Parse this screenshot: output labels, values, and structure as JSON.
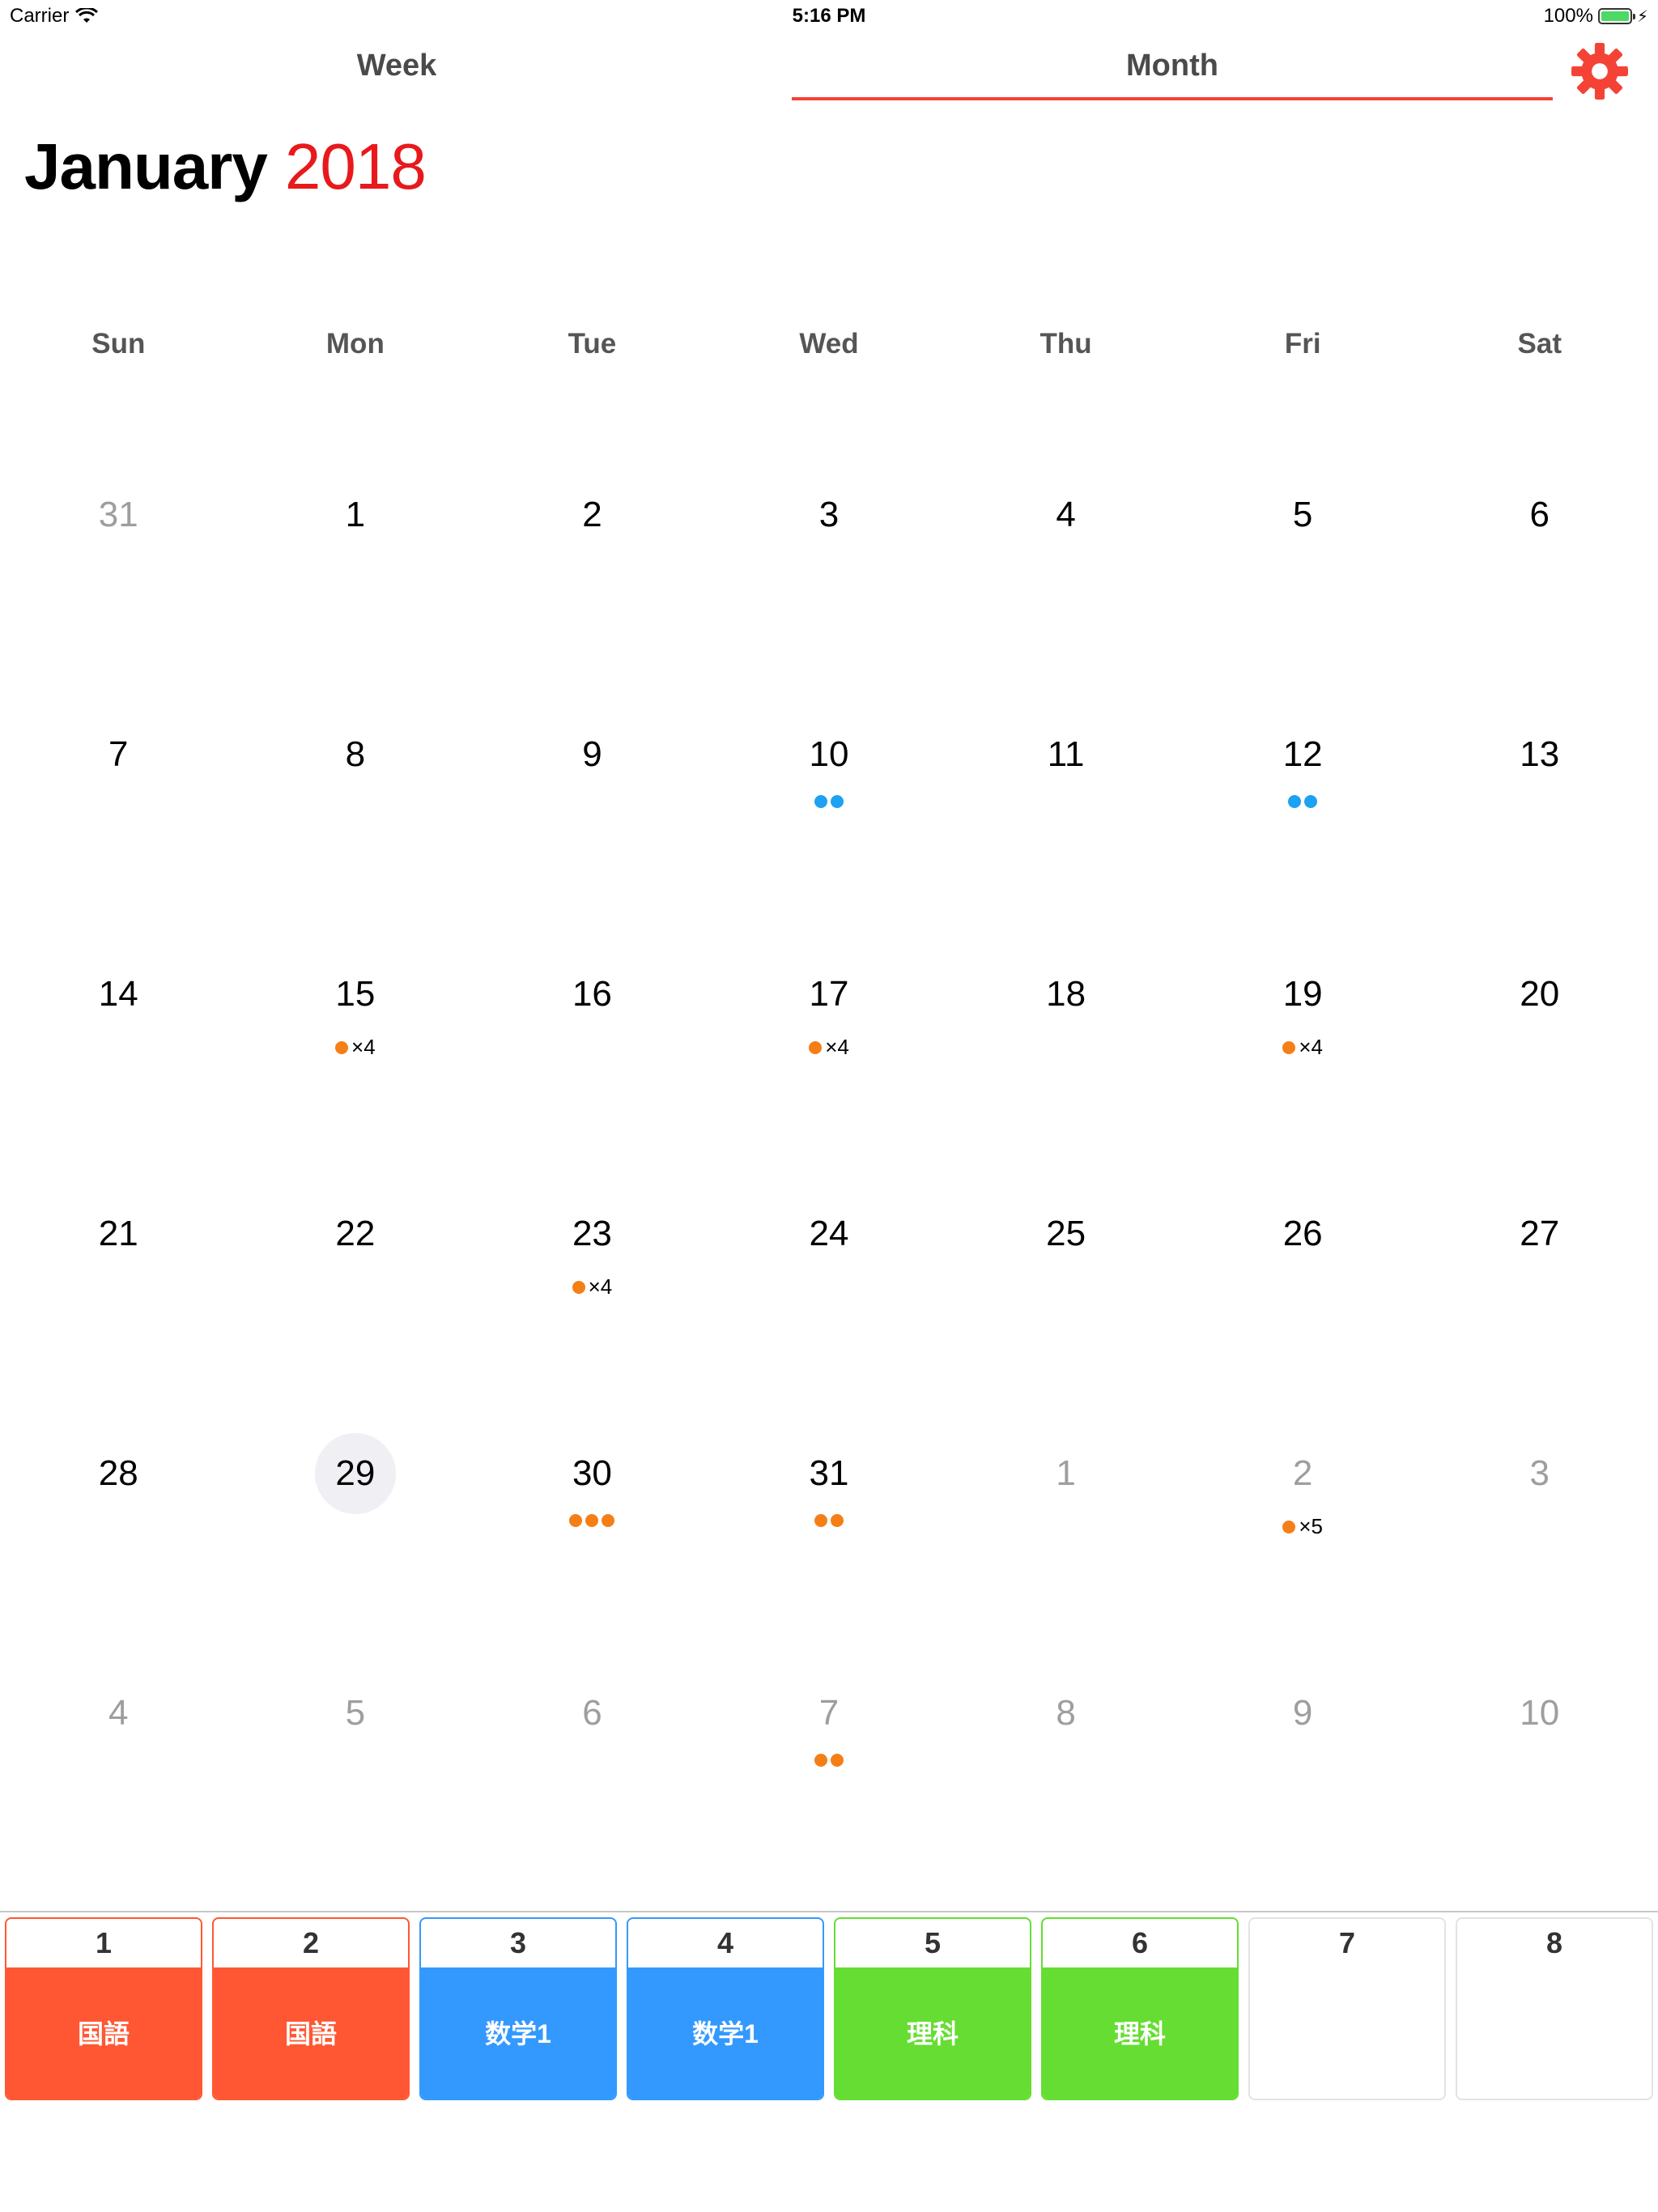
{
  "status_bar": {
    "carrier": "Carrier",
    "time": "5:16 PM",
    "battery": "100%",
    "battery_level": 1.0
  },
  "header": {
    "week_tab": "Week",
    "month_tab": "Month",
    "selected_tab": "Month",
    "accent": "#f44336"
  },
  "title": {
    "month": "January",
    "year": "2018",
    "year_color": "#e8191c"
  },
  "weekdays": [
    "Sun",
    "Mon",
    "Tue",
    "Wed",
    "Thu",
    "Fri",
    "Sat"
  ],
  "weeks": [
    [
      {
        "d": "31",
        "other": true
      },
      {
        "d": "1"
      },
      {
        "d": "2"
      },
      {
        "d": "3"
      },
      {
        "d": "4"
      },
      {
        "d": "5"
      },
      {
        "d": "6"
      }
    ],
    [
      {
        "d": "7"
      },
      {
        "d": "8"
      },
      {
        "d": "9"
      },
      {
        "d": "10",
        "dots": 2,
        "color": "blue"
      },
      {
        "d": "11"
      },
      {
        "d": "12",
        "dots": 2,
        "color": "blue"
      },
      {
        "d": "13"
      }
    ],
    [
      {
        "d": "14"
      },
      {
        "d": "15",
        "dots": 1,
        "color": "orange",
        "count": "×4"
      },
      {
        "d": "16"
      },
      {
        "d": "17",
        "dots": 1,
        "color": "orange",
        "count": "×4"
      },
      {
        "d": "18"
      },
      {
        "d": "19",
        "dots": 1,
        "color": "orange",
        "count": "×4"
      },
      {
        "d": "20"
      }
    ],
    [
      {
        "d": "21"
      },
      {
        "d": "22"
      },
      {
        "d": "23",
        "dots": 1,
        "color": "orange",
        "count": "×4"
      },
      {
        "d": "24"
      },
      {
        "d": "25"
      },
      {
        "d": "26"
      },
      {
        "d": "27"
      }
    ],
    [
      {
        "d": "28"
      },
      {
        "d": "29",
        "today": true
      },
      {
        "d": "30",
        "dots": 3,
        "color": "orange"
      },
      {
        "d": "31",
        "dots": 2,
        "color": "orange"
      },
      {
        "d": "1",
        "other": true
      },
      {
        "d": "2",
        "other": true,
        "dots": 1,
        "color": "orange",
        "count": "×5"
      },
      {
        "d": "3",
        "other": true
      }
    ],
    [
      {
        "d": "4",
        "other": true
      },
      {
        "d": "5",
        "other": true
      },
      {
        "d": "6",
        "other": true
      },
      {
        "d": "7",
        "other": true,
        "dots": 2,
        "color": "orange"
      },
      {
        "d": "8",
        "other": true
      },
      {
        "d": "9",
        "other": true
      },
      {
        "d": "10",
        "other": true
      }
    ]
  ],
  "periods": [
    {
      "num": "1",
      "subject": "国語",
      "color": "#ff5733"
    },
    {
      "num": "2",
      "subject": "国語",
      "color": "#ff5733"
    },
    {
      "num": "3",
      "subject": "数学1",
      "color": "#3399ff"
    },
    {
      "num": "4",
      "subject": "数学1",
      "color": "#3399ff"
    },
    {
      "num": "5",
      "subject": "理科",
      "color": "#66dd33"
    },
    {
      "num": "6",
      "subject": "理科",
      "color": "#66dd33"
    },
    {
      "num": "7",
      "subject": "",
      "color": ""
    },
    {
      "num": "8",
      "subject": "",
      "color": ""
    }
  ]
}
